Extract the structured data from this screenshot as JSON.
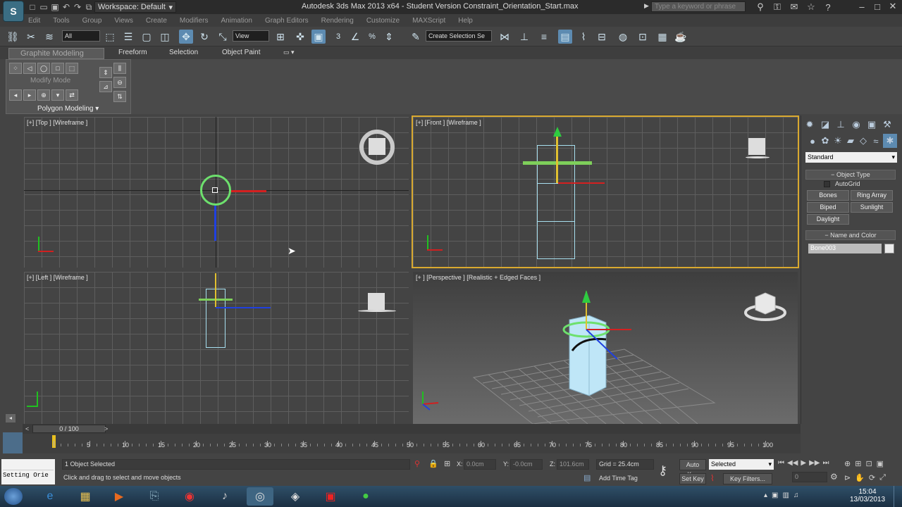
{
  "window": {
    "title": "Autodesk 3ds Max 2013 x64  -  Student Version    Constraint_Orientation_Start.max",
    "workspace_label": "Workspace: Default",
    "search_placeholder": "Type a keyword or phrase",
    "logo": "S"
  },
  "menu": [
    "Edit",
    "Tools",
    "Group",
    "Views",
    "Create",
    "Modifiers",
    "Animation",
    "Graph Editors",
    "Rendering",
    "Customize",
    "MAXScript",
    "Help"
  ],
  "toolbar": {
    "selection_filter": "All",
    "ref_coord": "View",
    "named_selection": "Create Selection Se",
    "snap_label": "3",
    "snap_pct": "%"
  },
  "ribbon": {
    "tabs": [
      "Graphite Modeling Tools",
      "Freeform",
      "Selection",
      "Object Paint"
    ],
    "panel_label": "Polygon Modeling",
    "modify_mode": "Modify Mode"
  },
  "viewports": [
    {
      "id": "top",
      "label": "[+] [Top ] [Wireframe ]"
    },
    {
      "id": "front",
      "label": "[+] [Front ] [Wireframe ]"
    },
    {
      "id": "left",
      "label": "[+] [Left ] [Wireframe ]"
    },
    {
      "id": "persp",
      "label": "[+ ] [Perspective ] [Realistic + Edged Faces ]"
    }
  ],
  "command_panel": {
    "dropdown": "Standard",
    "object_type_title": "Object Type",
    "autogrid": "AutoGrid",
    "buttons": [
      "Bones",
      "Ring Array",
      "Biped",
      "Sunlight",
      "Daylight"
    ],
    "name_color_title": "Name and Color",
    "object_name": "Bone003"
  },
  "timeline": {
    "frame_readout": "0 / 100",
    "ticks": [
      5,
      10,
      15,
      20,
      25,
      30,
      35,
      40,
      45,
      50,
      55,
      60,
      65,
      70,
      75,
      80,
      85,
      90,
      95,
      100
    ]
  },
  "status": {
    "maxscript": "Setting Orie",
    "selected": "1 Object Selected",
    "prompt": "Click and drag to select and move objects",
    "x_label": "X:",
    "x_value": "0.0cm",
    "y_label": "Y:",
    "y_value": "-0.0cm",
    "z_label": "Z:",
    "z_value": "101.6cm",
    "grid": "Grid = 25.4cm",
    "add_time_tag": "Add Time Tag",
    "auto_key": "Auto Key",
    "set_key": "Set Key",
    "selected_dropdown": "Selected",
    "key_filters": "Key Filters...",
    "frame": "0"
  },
  "taskbar": {
    "time": "15:04",
    "date": "13/03/2013"
  },
  "colors": {
    "active_border": "#d9a92f",
    "x_axis": "#e02020",
    "y_axis": "#20d020",
    "z_axis": "#2040e0",
    "bone": "#a8e0f0"
  }
}
